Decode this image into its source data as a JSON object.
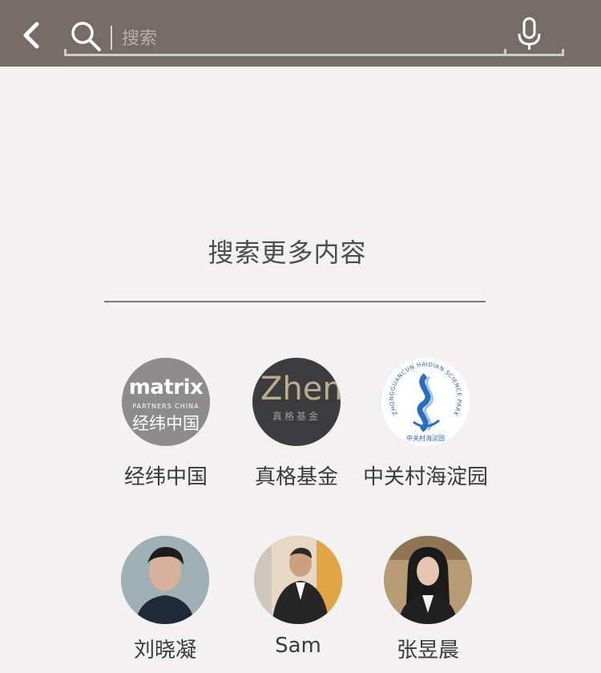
{
  "header": {
    "back_icon": "chevron-left-icon",
    "search_icon": "search-icon",
    "mic_icon": "microphone-icon",
    "search_placeholder": "搜索",
    "bar_color": "#766c67"
  },
  "main": {
    "heading": "搜索更多内容",
    "items": [
      {
        "label": "经纬中国",
        "logo_text": "matrix",
        "logo_sub": "PARTNERS CHINA",
        "logo_cn": "经纬中国"
      },
      {
        "label": "真格基金",
        "logo_text": "Zhen",
        "logo_cn": "真格基金"
      },
      {
        "label": "中关村海淀园",
        "logo_ring_text": "ZHONGGUANCUN HAIDIAN SCIENCE PARK",
        "logo_cn": "中关村海淀园"
      },
      {
        "label": "刘晓凝"
      },
      {
        "label": "Sam"
      },
      {
        "label": "张昱晨"
      }
    ]
  }
}
